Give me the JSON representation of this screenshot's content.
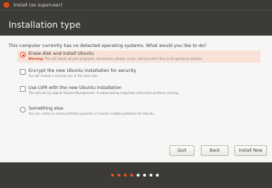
{
  "window": {
    "title": "Install (as superuser)"
  },
  "header": {
    "title": "Installation type"
  },
  "question": "This computer currently has no detected operating systems. What would you like to do?",
  "options": [
    {
      "label": "Erase disk and install Ubuntu",
      "warning_prefix": "Warning:",
      "description": "This will delete all your programs, documents, photos, music, and any other files in all operating systems.",
      "selected": true
    },
    {
      "label": "Encrypt the new Ubuntu installation for security",
      "description": "You will choose a security key in the next step.",
      "checked": false
    },
    {
      "label": "Use LVM with the new Ubuntu installation",
      "description": "This will set up Logical Volume Management. It allows taking snapshots and easier partition resizing.",
      "checked": false
    },
    {
      "label": "Something else",
      "description": "You can create or resize partitions yourself, or choose multiple partitions for Ubuntu.",
      "selected": false
    }
  ],
  "buttons": {
    "quit": "Quit",
    "back": "Back",
    "install": "Install Now"
  },
  "progress": {
    "total_steps": 8,
    "current_step": 4,
    "active_color": "#e95420",
    "inactive_color": "#ffffff"
  },
  "colors": {
    "accent": "#dd4814",
    "header_bg": "#3c3b37",
    "selected_bg": "#f8e2d8"
  }
}
